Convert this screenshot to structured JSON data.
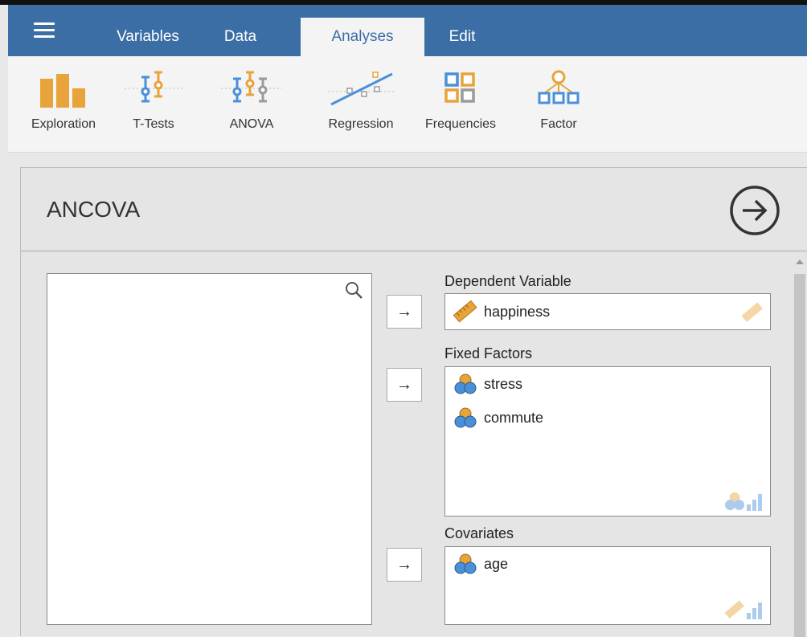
{
  "menu": {
    "tabs": [
      {
        "label": "Variables"
      },
      {
        "label": "Data"
      },
      {
        "label": "Analyses"
      },
      {
        "label": "Edit"
      }
    ]
  },
  "ribbon": {
    "items": [
      {
        "label": "Exploration",
        "icon": "exploration-icon"
      },
      {
        "label": "T-Tests",
        "icon": "t-tests-icon"
      },
      {
        "label": "ANOVA",
        "icon": "anova-icon"
      },
      {
        "label": "Regression",
        "icon": "regression-icon"
      },
      {
        "label": "Frequencies",
        "icon": "frequencies-icon"
      },
      {
        "label": "Factor",
        "icon": "factor-icon"
      }
    ]
  },
  "panel": {
    "title": "ANCOVA",
    "dependent": {
      "label": "Dependent Variable",
      "items": [
        {
          "name": "happiness",
          "icon": "continuous-ruler-icon"
        }
      ]
    },
    "fixed_factors": {
      "label": "Fixed Factors",
      "items": [
        {
          "name": "stress",
          "icon": "nominal-circles-icon"
        },
        {
          "name": "commute",
          "icon": "nominal-circles-icon"
        }
      ]
    },
    "covariates": {
      "label": "Covariates",
      "items": [
        {
          "name": "age",
          "icon": "nominal-circles-icon"
        }
      ]
    },
    "arrow_glyph": "→"
  },
  "colors": {
    "menubar": "#3b6ea5",
    "accent_orange": "#e8a33a",
    "accent_blue": "#4a90d9"
  }
}
